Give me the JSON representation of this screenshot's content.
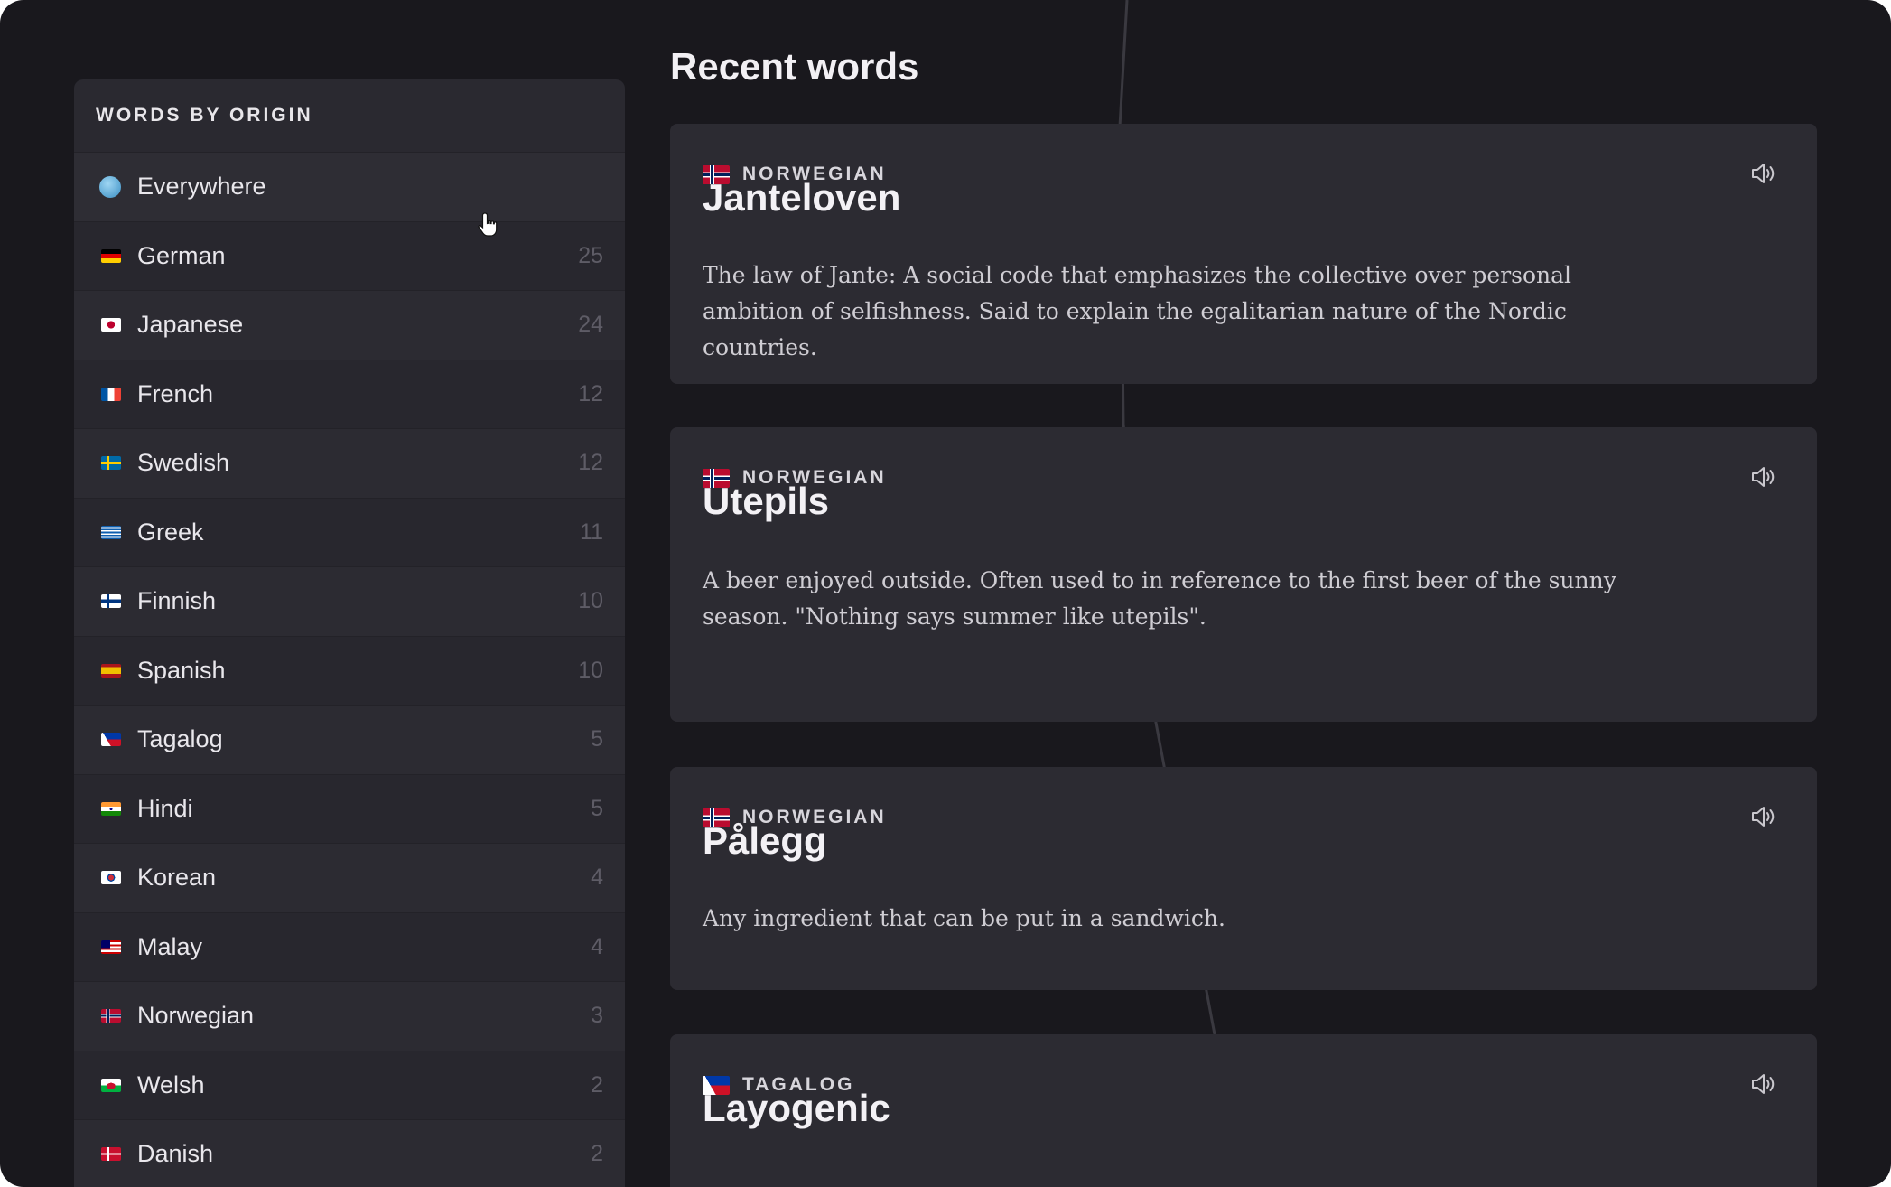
{
  "sidebar": {
    "title": "WORDS BY ORIGIN",
    "items": [
      {
        "label": "Everywhere",
        "count": "",
        "flag": "globe"
      },
      {
        "label": "German",
        "count": "25",
        "flag": "de"
      },
      {
        "label": "Japanese",
        "count": "24",
        "flag": "jp"
      },
      {
        "label": "French",
        "count": "12",
        "flag": "fr"
      },
      {
        "label": "Swedish",
        "count": "12",
        "flag": "se"
      },
      {
        "label": "Greek",
        "count": "11",
        "flag": "gr"
      },
      {
        "label": "Finnish",
        "count": "10",
        "flag": "fi"
      },
      {
        "label": "Spanish",
        "count": "10",
        "flag": "es"
      },
      {
        "label": "Tagalog",
        "count": "5",
        "flag": "ph"
      },
      {
        "label": "Hindi",
        "count": "5",
        "flag": "in"
      },
      {
        "label": "Korean",
        "count": "4",
        "flag": "kr"
      },
      {
        "label": "Malay",
        "count": "4",
        "flag": "my"
      },
      {
        "label": "Norwegian",
        "count": "3",
        "flag": "no"
      },
      {
        "label": "Welsh",
        "count": "2",
        "flag": "wales"
      },
      {
        "label": "Danish",
        "count": "2",
        "flag": "dk"
      }
    ]
  },
  "main": {
    "title": "Recent words",
    "cards": [
      {
        "origin": "NORWEGIAN",
        "flag": "no",
        "word": "Janteloven",
        "definition": "The law of Jante: A social code that emphasizes the collective over personal ambition of selfishness. Said to explain the egalitarian nature of the Nordic countries."
      },
      {
        "origin": "NORWEGIAN",
        "flag": "no",
        "word": "Utepils",
        "definition": "A beer enjoyed outside. Often used to in reference to the first beer of the sunny season. \"Nothing says summer like utepils\"."
      },
      {
        "origin": "NORWEGIAN",
        "flag": "no",
        "word": "Pålegg",
        "definition": "Any ingredient that can be put in a sandwich."
      },
      {
        "origin": "TAGALOG",
        "flag": "ph",
        "word": "Layogenic",
        "definition": ""
      }
    ]
  },
  "icons": {
    "speaker": "speaker-icon",
    "cursor": "hand-pointer-icon",
    "globe": "globe-icon"
  },
  "colors": {
    "background": "#19181d",
    "panel": "#2a2930",
    "card": "#2c2b32",
    "text": "#e9e7ec",
    "muted": "#5e5c66"
  }
}
